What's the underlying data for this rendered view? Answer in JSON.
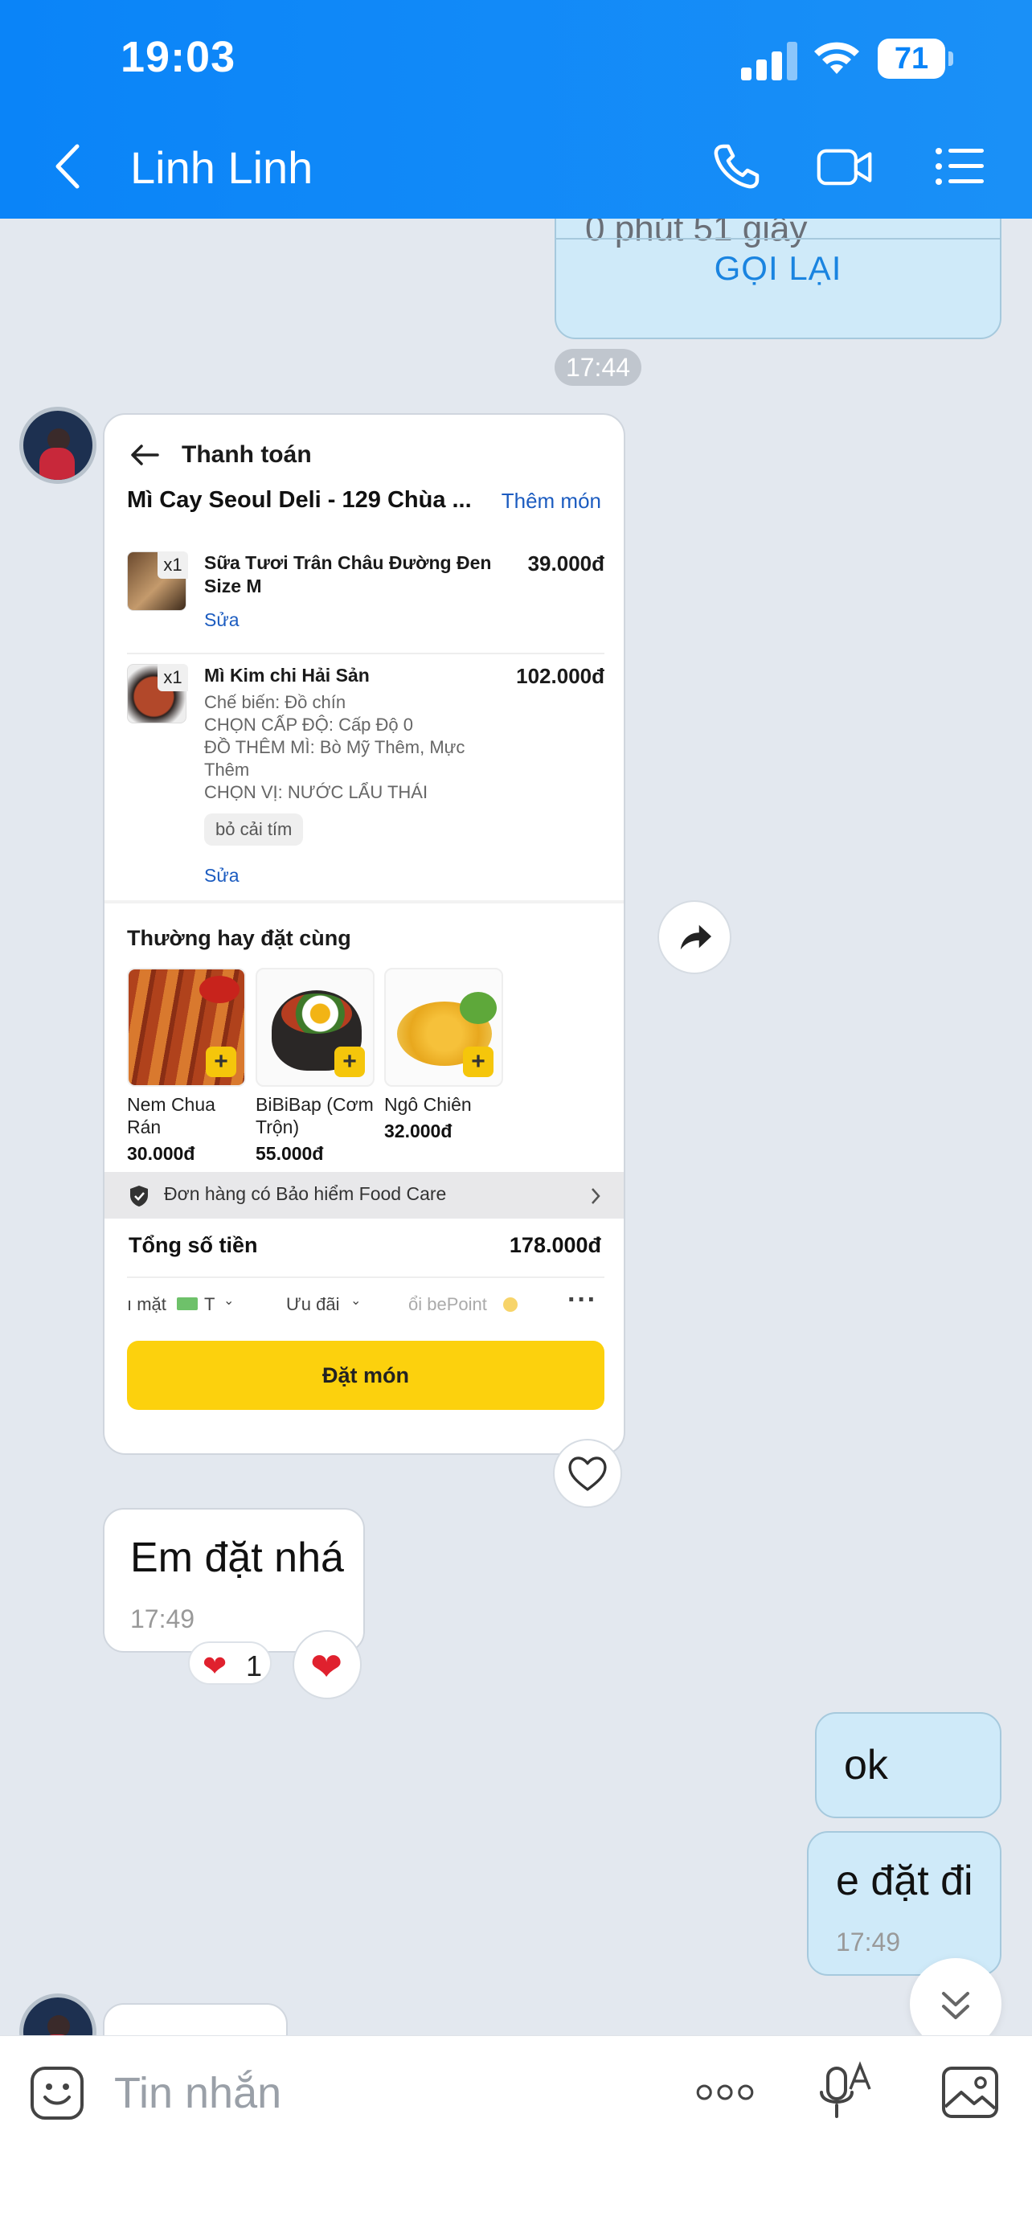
{
  "status_bar": {
    "time": "19:03",
    "battery": "71"
  },
  "header": {
    "contact_name": "Linh Linh"
  },
  "call_card": {
    "duration": "0 phút 51 giây",
    "call_again": "GỌI LẠI"
  },
  "time_chip": "17:44",
  "checkout": {
    "title": "Thanh toán",
    "restaurant": "Mì Cay Seoul Deli - 129 Chùa ...",
    "add_more": "Thêm món",
    "items": [
      {
        "qty": "x1",
        "name": "Sữa Tươi Trân Châu Đường Đen Size M",
        "price": "39.000đ",
        "edit": "Sửa"
      },
      {
        "qty": "x1",
        "name": "Mì Kim chi Hải Sản",
        "price": "102.000đ",
        "options": [
          "Chế biến: Đồ chín",
          "CHỌN CẤP ĐỘ: Cấp Độ 0",
          "ĐỒ THÊM MÌ: Bò Mỹ Thêm, Mực",
          "Thêm",
          "CHỌN VỊ: NƯỚC LẨU THÁI"
        ],
        "note": "bỏ cải tím",
        "edit": "Sửa"
      }
    ],
    "frequent_title": "Thường hay đặt cùng",
    "suggestions": [
      {
        "name_line1": "Nem Chua",
        "name_line2": "Rán",
        "price": "30.000đ"
      },
      {
        "name_line1": "BiBiBap (Cơm",
        "name_line2": "Trộn)",
        "price": "55.000đ"
      },
      {
        "name_line1": "Ngô Chiên",
        "name_line2": "",
        "price": "32.000đ"
      }
    ],
    "insurance": "Đơn hàng có Bảo hiểm Food Care",
    "total_label": "Tổng số tiền",
    "total_value": "178.000đ",
    "payment": {
      "cash": "ı mặt",
      "cash_code": "T",
      "promo": "Ưu đãi",
      "points": "ổi bePoint"
    },
    "order_button": "Đặt món"
  },
  "messages": [
    {
      "text": "Em đặt nhá",
      "time": "17:49",
      "reaction_count": "1"
    },
    {
      "text": "ok"
    },
    {
      "text": "e đặt đi",
      "time": "17:49"
    }
  ],
  "input_bar": {
    "placeholder": "Tin nhắn"
  }
}
